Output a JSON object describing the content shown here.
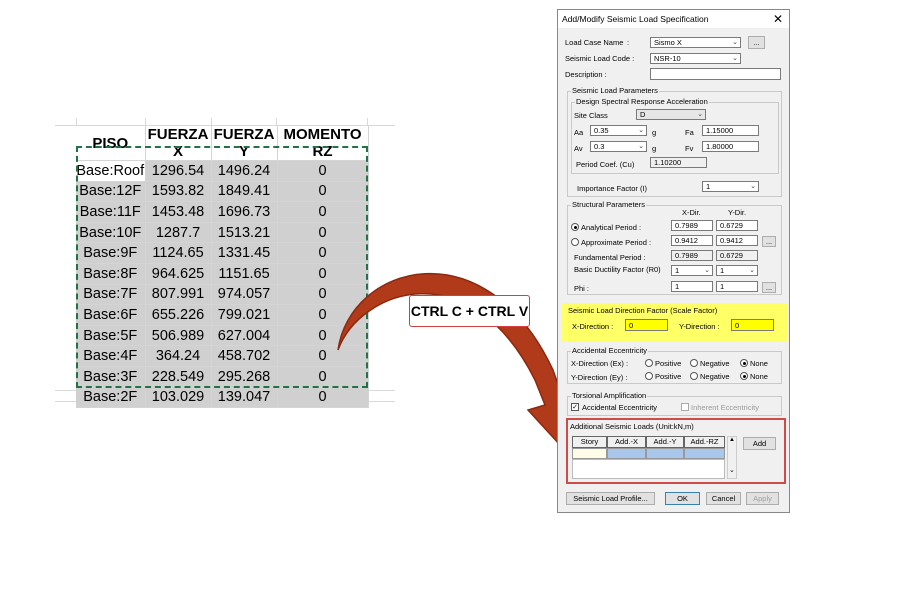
{
  "sheet": {
    "headers": [
      "PISO",
      "FUERZA X",
      "FUERZA Y",
      "MOMENTO RZ"
    ],
    "rows": [
      [
        "Base:Roof",
        "1296.54",
        "1496.24",
        "0"
      ],
      [
        "Base:12F",
        "1593.82",
        "1849.41",
        "0"
      ],
      [
        "Base:11F",
        "1453.48",
        "1696.73",
        "0"
      ],
      [
        "Base:10F",
        "1287.7",
        "1513.21",
        "0"
      ],
      [
        "Base:9F",
        "1124.65",
        "1331.45",
        "0"
      ],
      [
        "Base:8F",
        "964.625",
        "1151.65",
        "0"
      ],
      [
        "Base:7F",
        "807.991",
        "974.057",
        "0"
      ],
      [
        "Base:6F",
        "655.226",
        "799.021",
        "0"
      ],
      [
        "Base:5F",
        "506.989",
        "627.004",
        "0"
      ],
      [
        "Base:4F",
        "364.24",
        "458.702",
        "0"
      ],
      [
        "Base:3F",
        "228.549",
        "295.268",
        "0"
      ],
      [
        "Base:2F",
        "103.029",
        "139.047",
        "0"
      ]
    ]
  },
  "arrow": {
    "label": "CTRL C + CTRL V",
    "color": "#b03a1a"
  },
  "dialog": {
    "title": "Add/Modify Seismic Load Specification",
    "close_icon": "✕",
    "load_case_name_label": "Load Case Name",
    "load_case_colon": ":",
    "load_case_name": "Sismo X",
    "more_button": "...",
    "seismic_load_code_label": "Seismic Load Code :",
    "seismic_load_code": "NSR-10",
    "description_label": "Description :",
    "description": "",
    "params_group": "Seismic Load Parameters",
    "spectral_group": "Design Spectral Response Acceleration",
    "site_class_label": "Site Class",
    "site_class": "D",
    "aa_label": "Aa",
    "aa_value": "0.35",
    "g1": "g",
    "fa_label": "Fa",
    "fa_value": "1.15000",
    "av_label": "Av",
    "av_value": "0.3",
    "g2": "g",
    "fv_label": "Fv",
    "fv_value": "1.80000",
    "period_coef_label": "Period Coef. (Cu)",
    "period_coef_value": "1.10200",
    "importance_label": "Importance Factor (I)",
    "importance_value": "1",
    "structural_group": "Structural Parameters",
    "xdir_hdr": "X-Dir.",
    "ydir_hdr": "Y-Dir.",
    "analytical_label": "Analytical Period :",
    "analytical_x": "0.7989",
    "analytical_y": "0.6729",
    "approximate_label": "Approximate Period :",
    "approximate_x": "0.9412",
    "approximate_y": "0.9412",
    "fundamental_label": "Fundamental Period :",
    "fundamental_x": "0.7989",
    "fundamental_y": "0.6729",
    "ductility_label": "Basic Ductility Factor (R0)",
    "ductility_x": "1",
    "ductility_y": "1",
    "phi_label": "Phi :",
    "phi_x": "1",
    "phi_y": "1",
    "direction_factor_group": "Seismic Load Direction Factor (Scale Factor)",
    "x_direction_label": "X-Direction :",
    "x_direction_value": "0",
    "y_direction_label": "Y-Direction :",
    "y_direction_value": "0",
    "accidental_group": "Accidental Eccentricity",
    "ex_label": "X-Direction (Ex) :",
    "ey_label": "Y-Direction (Ey) :",
    "positive": "Positive",
    "negative": "Negative",
    "none": "None",
    "torsional_group": "Torsional Amplification",
    "accidental_ecc_check": "Accidental Eccentricity",
    "inherent_ecc_check": "Inherent Eccentricity",
    "additional_group": "Additional Seismic Loads (Unit:kN,m)",
    "grid_headers": [
      "Story",
      "Add.-X",
      "Add.-Y",
      "Add.-RZ"
    ],
    "add_button": "Add",
    "profile_button": "Seismic Load Profile...",
    "ok_button": "OK",
    "cancel_button": "Cancel",
    "apply_button": "Apply",
    "check_mark": "✓",
    "scroll_up": "▲",
    "scroll_down": "⌄",
    "dropdown_icon": "⌄"
  },
  "colors": {
    "selection_border": "#217346",
    "highlight_yellow": "#ffff66",
    "red_outline": "#d04a4a",
    "arrow": "#b03a1a"
  }
}
